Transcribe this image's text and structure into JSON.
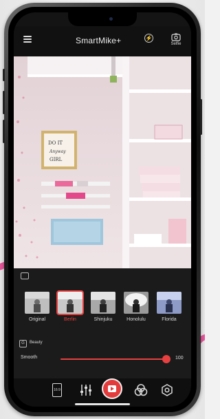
{
  "app": {
    "title": "SmartMike+",
    "selfie_label": "Selfie"
  },
  "filters": {
    "selected_index": 1,
    "items": [
      {
        "label": "Original"
      },
      {
        "label": "Berlin"
      },
      {
        "label": "Shinjuku"
      },
      {
        "label": "Honolulu"
      },
      {
        "label": "Florida"
      }
    ]
  },
  "beauty": {
    "label": "Beauty",
    "smooth_label": "Smooth",
    "smooth_value": "100",
    "smooth_fraction": 0.96
  },
  "toolbar": {
    "ratio_label": "16:9",
    "icons": [
      "aspect-ratio-icon",
      "sliders-icon",
      "record-icon",
      "filters-icon",
      "settings-icon"
    ]
  },
  "colors": {
    "accent": "#e84040",
    "arrow": "#e4569a",
    "panel": "#1c1c1c"
  }
}
